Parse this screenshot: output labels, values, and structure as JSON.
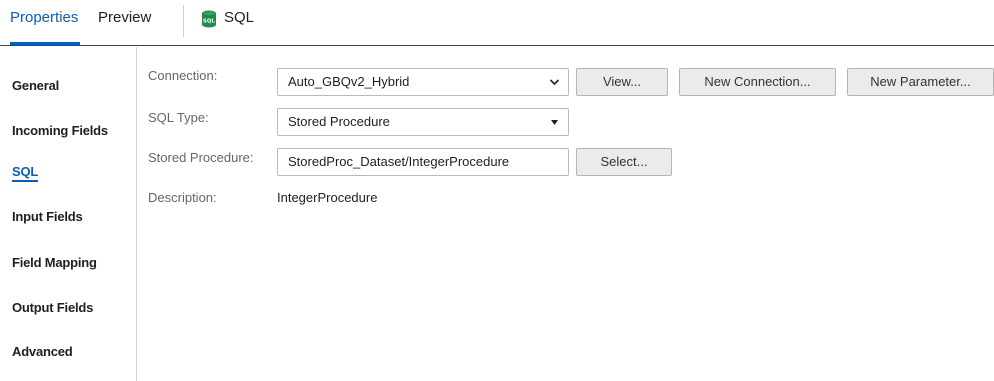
{
  "tabs": {
    "properties": "Properties",
    "preview": "Preview"
  },
  "object": {
    "title": "SQL",
    "icon": "sql-database-icon"
  },
  "sidenav": {
    "items": [
      {
        "label": "General"
      },
      {
        "label": "Incoming Fields"
      },
      {
        "label": "SQL"
      },
      {
        "label": "Input Fields"
      },
      {
        "label": "Field Mapping"
      },
      {
        "label": "Output Fields"
      },
      {
        "label": "Advanced"
      }
    ],
    "active": "SQL"
  },
  "form": {
    "connection": {
      "label": "Connection:",
      "value": "Auto_GBQv2_Hybrid",
      "view_button": "View...",
      "new_connection_button": "New Connection...",
      "new_parameter_button": "New Parameter..."
    },
    "sql_type": {
      "label": "SQL Type:",
      "value": "Stored Procedure"
    },
    "stored_procedure": {
      "label": "Stored Procedure:",
      "value": "StoredProc_Dataset/IntegerProcedure",
      "select_button": "Select..."
    },
    "description": {
      "label": "Description:",
      "value": "IntegerProcedure"
    }
  },
  "colors": {
    "accent": "#0a5fb4",
    "sql_icon": "#1f8a4c"
  }
}
